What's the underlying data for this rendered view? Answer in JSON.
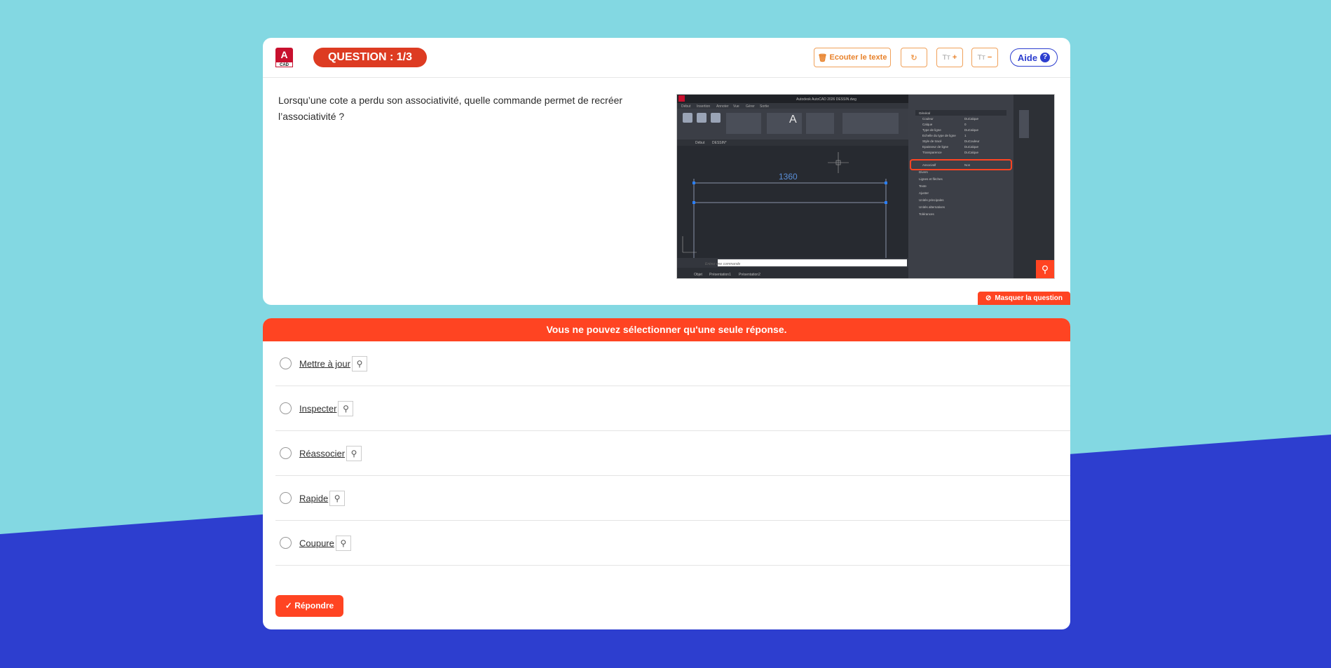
{
  "header": {
    "logo_letter": "A",
    "logo_sub": "CAD",
    "question_badge": "QUESTION : 1/3",
    "listen_label": "Ecouter le texte",
    "reload_icon": "reload-icon",
    "font_plus_label": "+",
    "font_minus_label": "−",
    "help_label": "Aide",
    "help_icon_glyph": "?"
  },
  "question": {
    "text": "Lorsqu’une cote a perdu son associativité, quelle commande permet de recréer l’associativité ?",
    "hide_label": "Masquer la question"
  },
  "screenshot": {
    "title_bar": "Autodesk AutoCAD 2026   DESSIN.dwg",
    "ribbon_tabs": [
      "Début",
      "Insertion",
      "Annoter",
      "Vue",
      "Gérer",
      "Sortie"
    ],
    "dimension_value": "1360",
    "command_placeholder": "Entrez une commande",
    "layout_tabs": [
      "Objet",
      "Présentation1",
      "Présentation2"
    ],
    "doc_tabs": [
      "Début",
      "DESSIN*"
    ],
    "properties_rows": [
      [
        "Couleur",
        "DuCalque"
      ],
      [
        "Calque",
        "0"
      ],
      [
        "Type de ligne",
        "DuCalque"
      ],
      [
        "Echelle du type de ligne",
        "1"
      ],
      [
        "Style de tracé",
        "DuCouleur"
      ],
      [
        "Epaisseur de ligne",
        "DuCalque"
      ],
      [
        "Transparence",
        "DuCalque"
      ]
    ],
    "highlight_row": [
      "Associatif",
      "Non"
    ],
    "sections": [
      "Général",
      "Divers",
      "Lignes et flèches",
      "Texte",
      "Ajuster",
      "Unités principales",
      "Unités alternatives",
      "Tolérances"
    ]
  },
  "answers": {
    "instruction": "Vous ne pouvez sélectionner qu'une seule réponse.",
    "options": [
      {
        "label": "Mettre à jour"
      },
      {
        "label": "Inspecter"
      },
      {
        "label": "Réassocier"
      },
      {
        "label": "Rapide"
      },
      {
        "label": "Coupure"
      }
    ],
    "submit_label": "Répondre"
  },
  "colors": {
    "accent": "#ff4422",
    "background": "#83d8e2",
    "wave": "#2d3ecf",
    "help": "#2c3ecf"
  }
}
